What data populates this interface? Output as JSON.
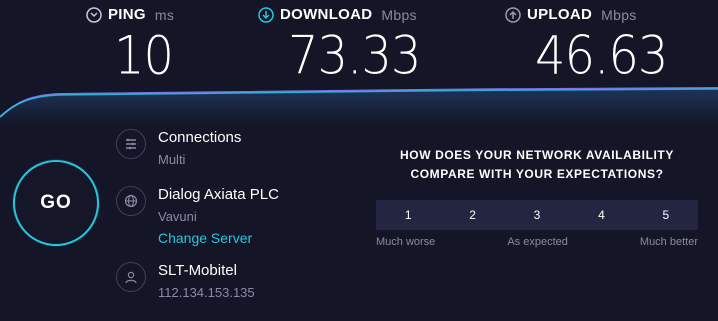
{
  "metrics": {
    "ping": {
      "label": "PING",
      "unit": "ms",
      "value": "10",
      "icon": "ping-icon"
    },
    "download": {
      "label": "DOWNLOAD",
      "unit": "Mbps",
      "value": "73.33",
      "icon": "download-icon"
    },
    "upload": {
      "label": "UPLOAD",
      "unit": "Mbps",
      "value": "46.63",
      "icon": "upload-icon"
    }
  },
  "go_button": {
    "label": "GO"
  },
  "connections": {
    "title": "Connections",
    "value": "Multi",
    "icon": "connections-icon"
  },
  "server": {
    "name": "Dialog Axiata PLC",
    "location": "Vavuni",
    "change_label": "Change Server",
    "icon": "globe-icon"
  },
  "isp": {
    "name": "SLT-Mobitel",
    "ip": "112.134.153.135",
    "icon": "user-icon"
  },
  "survey": {
    "question_line1": "HOW DOES YOUR NETWORK AVAILABILITY",
    "question_line2": "COMPARE WITH YOUR EXPECTATIONS?",
    "options": [
      "1",
      "2",
      "3",
      "4",
      "5"
    ],
    "scale_low": "Much worse",
    "scale_mid": "As expected",
    "scale_high": "Much better"
  },
  "colors": {
    "accent": "#27c6df",
    "background": "#141526",
    "muted": "#8a8aa6"
  }
}
